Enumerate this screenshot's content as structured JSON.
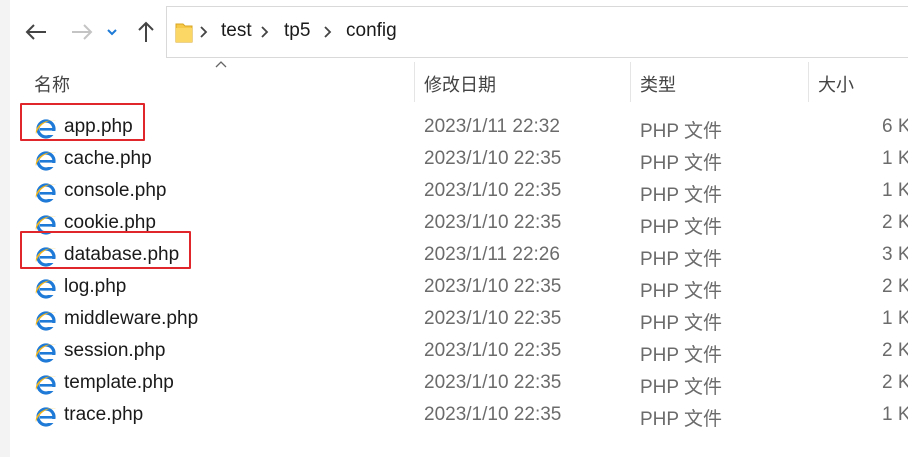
{
  "breadcrumb": {
    "items": [
      "test",
      "tp5",
      "config"
    ]
  },
  "columns": {
    "name": "名称",
    "date": "修改日期",
    "type": "类型",
    "size": "大小"
  },
  "files": [
    {
      "name": "app.php",
      "date": "2023/1/11 22:32",
      "type": "PHP 文件",
      "size": "6 K",
      "highlighted": true
    },
    {
      "name": "cache.php",
      "date": "2023/1/10 22:35",
      "type": "PHP 文件",
      "size": "1 K"
    },
    {
      "name": "console.php",
      "date": "2023/1/10 22:35",
      "type": "PHP 文件",
      "size": "1 K"
    },
    {
      "name": "cookie.php",
      "date": "2023/1/10 22:35",
      "type": "PHP 文件",
      "size": "2 K"
    },
    {
      "name": "database.php",
      "date": "2023/1/11 22:26",
      "type": "PHP 文件",
      "size": "3 K",
      "highlighted": true
    },
    {
      "name": "log.php",
      "date": "2023/1/10 22:35",
      "type": "PHP 文件",
      "size": "2 K"
    },
    {
      "name": "middleware.php",
      "date": "2023/1/10 22:35",
      "type": "PHP 文件",
      "size": "1 K"
    },
    {
      "name": "session.php",
      "date": "2023/1/10 22:35",
      "type": "PHP 文件",
      "size": "2 K"
    },
    {
      "name": "template.php",
      "date": "2023/1/10 22:35",
      "type": "PHP 文件",
      "size": "2 K"
    },
    {
      "name": "trace.php",
      "date": "2023/1/10 22:35",
      "type": "PHP 文件",
      "size": "1 K"
    }
  ],
  "colors": {
    "highlight": "#e0262b",
    "folder": "#f7c948",
    "ie_blue": "#1e7ad6",
    "ie_ring": "#f2b51b"
  },
  "icons": {
    "back": "arrow-left-icon",
    "forward": "arrow-right-icon",
    "recent": "chevron-down-icon",
    "up": "arrow-up-icon",
    "folder": "folder-icon",
    "file": "php-file-icon"
  }
}
